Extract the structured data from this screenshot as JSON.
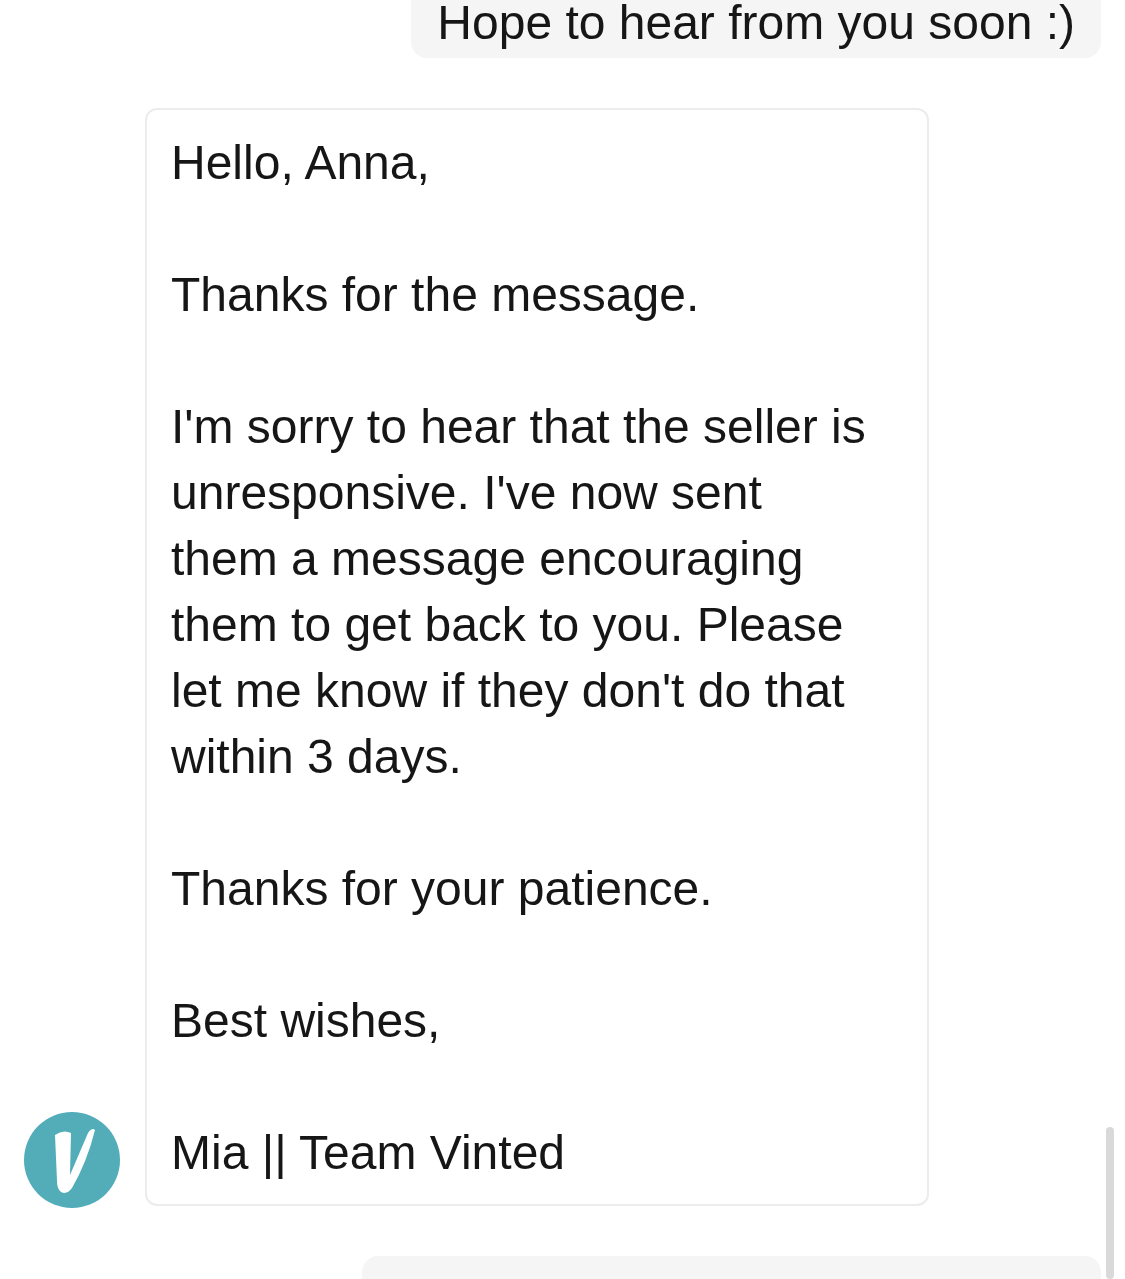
{
  "messages": [
    {
      "kind": "sent",
      "text": "Hope to hear from you soon :)"
    },
    {
      "kind": "received",
      "paragraphs": [
        "Hello, Anna,",
        "Thanks for the message.",
        "I'm sorry to hear that the seller is unresponsive. I've now sent them a message encouraging them to get back to you. Please let me know if they don't do that within 3 days.",
        "Thanks for your patience.",
        "Best wishes,",
        "Mia || Team Vinted"
      ]
    },
    {
      "kind": "sent"
    }
  ]
}
